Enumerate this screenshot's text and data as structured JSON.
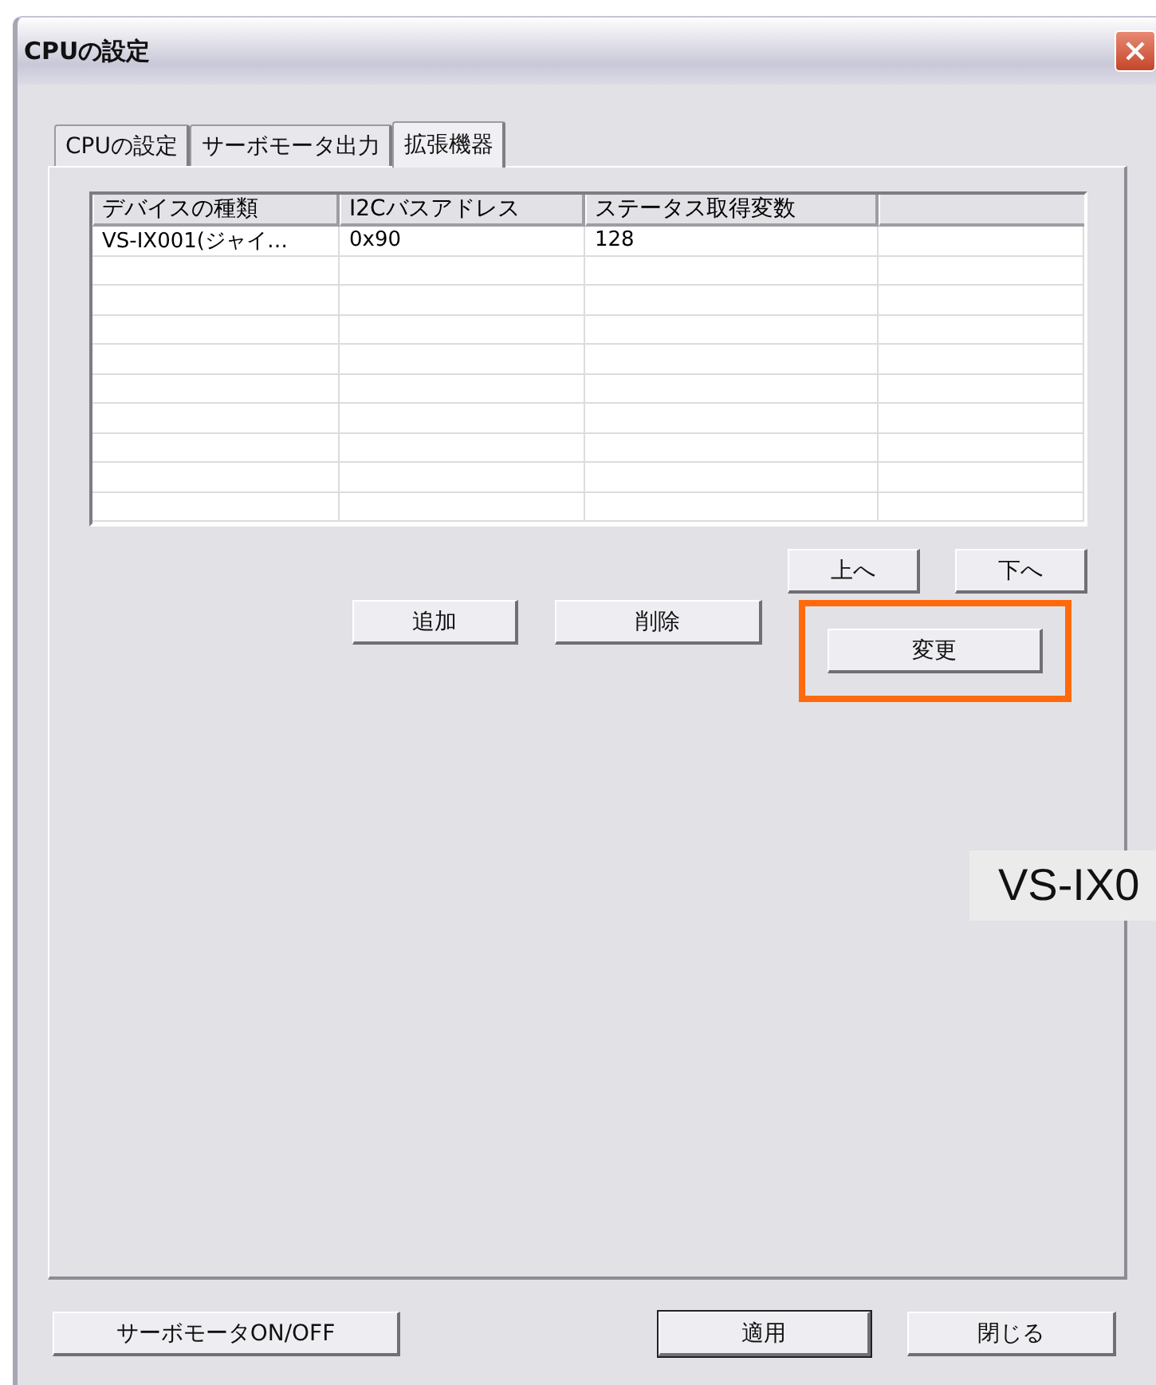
{
  "window": {
    "title": "CPUの設定"
  },
  "tabs": [
    {
      "label": "CPUの設定",
      "selected": false
    },
    {
      "label": "サーボモータ出力",
      "selected": false
    },
    {
      "label": "拡張機器",
      "selected": true
    }
  ],
  "table": {
    "columns": [
      "デバイスの種類",
      "I2Cバスアドレス",
      "ステータス取得変数"
    ],
    "rows": [
      [
        "VS-IX001(ジャイ…",
        "0x90",
        "128"
      ]
    ]
  },
  "order_buttons": [
    "上へ",
    "下へ"
  ],
  "edit_buttons": [
    {
      "label": "追加",
      "highlighted": false
    },
    {
      "label": "削除",
      "highlighted": false
    },
    {
      "label": "変更",
      "highlighted": true
    }
  ],
  "caption_overlay": "VS-IX0",
  "footer": {
    "servo_button": "サーボモータON/OFF",
    "apply_button": {
      "label": "適用",
      "default": true
    },
    "close_button": "閉じる"
  }
}
